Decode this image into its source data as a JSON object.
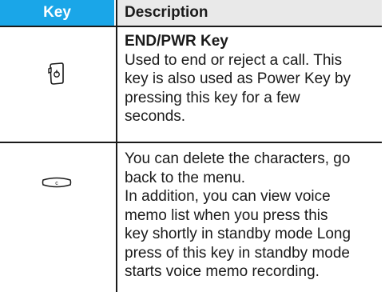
{
  "table": {
    "header": {
      "key": "Key",
      "description": "Description"
    },
    "rows": [
      {
        "key_icon": "end-pwr-key-icon",
        "title": "END/PWR Key",
        "lines": [
          "Used to end or reject a call. This",
          "key is also used as Power Key by",
          "pressing this key for a few",
          "seconds."
        ]
      },
      {
        "key_icon": "clear-key-icon",
        "lines": [
          "You can delete the characters, go",
          "back to the menu.",
          "In addition, you can view voice",
          "memo list when you press this",
          "key shortly in standby mode Long",
          "press of this key in standby mode",
          "starts voice memo recording."
        ]
      }
    ]
  },
  "colors": {
    "header_key_bg": "#1aa6e8",
    "header_desc_bg": "#e9e9e9",
    "rule": "#1a1a1a"
  }
}
